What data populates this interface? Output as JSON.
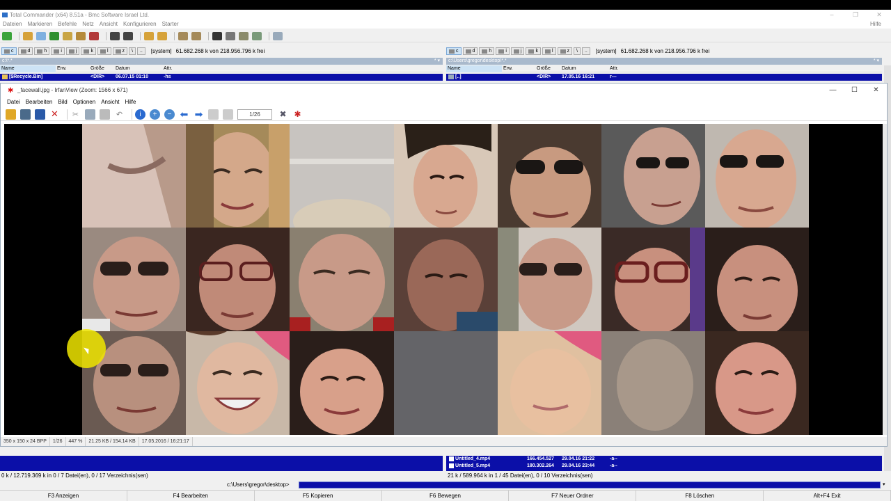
{
  "tc": {
    "title": "Total Commander (x64) 8.51a - Bmc Software Israel Ltd.",
    "menu": [
      "Dateien",
      "Markieren",
      "Befehle",
      "Netz",
      "Ansicht",
      "Konfigurieren",
      "Starter"
    ],
    "help": "Hilfe",
    "left": {
      "drives": [
        "c",
        "d",
        "h",
        "i",
        "j",
        "k",
        "l",
        "z",
        "\\",
        ".."
      ],
      "drive_label": "[system]",
      "free": "61.682.268 k von 218.956.796 k frei",
      "path": "c:\\*.*",
      "path_right": "* ▾",
      "columns": [
        "Name",
        "Erw.",
        "Größe",
        "Datum",
        "Attr."
      ],
      "row": {
        "name": "[$Recycle.Bin]",
        "size": "<DIR>",
        "date": "06.07.15 01:10",
        "attr": "-hs"
      },
      "status": "0 k / 12.719.369 k in 0 / 7 Datei(en), 0 / 17 Verzeichnis(sen)"
    },
    "right": {
      "drives": [
        "c",
        "d",
        "h",
        "i",
        "j",
        "k",
        "l",
        "z",
        "\\",
        ".."
      ],
      "drive_label": "[system]",
      "free": "61.682.268 k von 218.956.796 k frei",
      "path": "c:\\Users\\gregor\\desktop\\*.*",
      "path_right": "* ▾",
      "columns": [
        "Name",
        "Erw.",
        "Größe",
        "Datum",
        "Attr."
      ],
      "row": {
        "name": "[..]",
        "size": "<DIR>",
        "date": "17.05.16 16:21",
        "attr": "r---"
      },
      "bottom_rows": [
        {
          "name": "Untitled_4.mp4",
          "size": "166.454.527",
          "date": "29.04.16 21:22",
          "attr": "-a--"
        },
        {
          "name": "Untitled_5.mp4",
          "size": "180.302.264",
          "date": "29.04.16 23:44",
          "attr": "-a--"
        }
      ],
      "status": "21 k / 589.964 k in 1 / 45 Datei(en), 0 / 10 Verzeichnis(sen)"
    },
    "cmd_path": "c:\\Users\\gregor\\desktop>",
    "fkeys": [
      "F3 Anzeigen",
      "F4 Bearbeiten",
      "F5 Kopieren",
      "F6 Bewegen",
      "F7 Neuer Ordner",
      "F8 Löschen",
      "Alt+F4 Exit"
    ]
  },
  "iv": {
    "title": "_facewall.jpg - IrfanView (Zoom: 1566 x 671)",
    "menu": [
      "Datei",
      "Bearbeiten",
      "Bild",
      "Optionen",
      "Ansicht",
      "Hilfe"
    ],
    "page": "1/26",
    "status": [
      "350 x 150 x 24 BPP",
      "1/26",
      "447 %",
      "21.25 KB / 154.14 KB",
      "17.05.2016 / 16:21:17"
    ]
  },
  "colors": {
    "selection": "#0b0fa8",
    "highlight": "#f0e600"
  }
}
